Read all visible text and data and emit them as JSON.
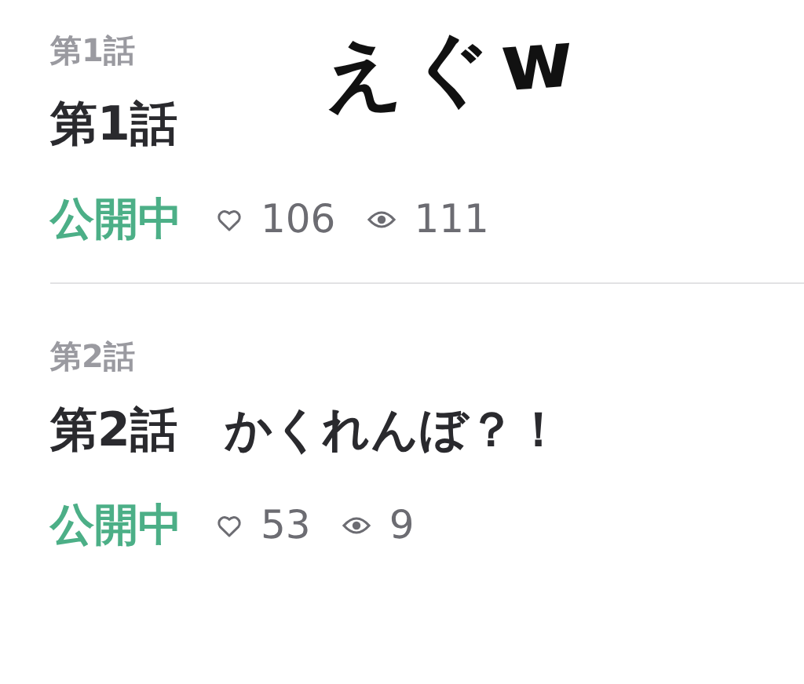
{
  "annotation": "えぐw",
  "episodes": [
    {
      "number": "第1話",
      "title": "第1話",
      "status": "公開中",
      "likes": "106",
      "views": "111"
    },
    {
      "number": "第2話",
      "title": "第2話　かくれんぼ？！",
      "status": "公開中",
      "likes": "53",
      "views": "9"
    }
  ]
}
